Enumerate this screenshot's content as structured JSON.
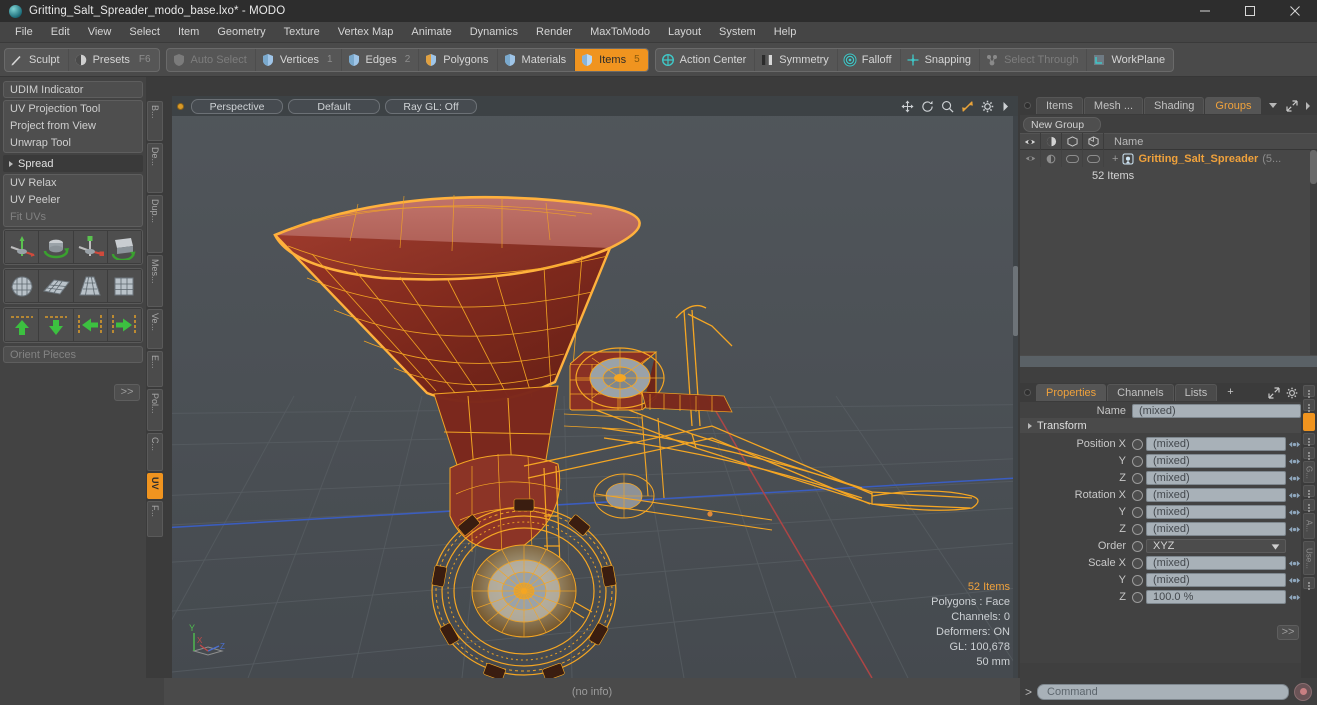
{
  "window": {
    "title": "Gritting_Salt_Spreader_modo_base.lxo* - MODO",
    "app_icon": "modo-sphere-icon",
    "minimize": "—",
    "maximize": "□",
    "close": "✕"
  },
  "menubar": {
    "items": [
      "File",
      "Edit",
      "View",
      "Select",
      "Item",
      "Geometry",
      "Texture",
      "Vertex Map",
      "Animate",
      "Dynamics",
      "Render",
      "MaxToModo",
      "Layout",
      "System",
      "Help"
    ]
  },
  "toolbar": {
    "groups": [
      {
        "buttons": [
          {
            "label": "Sculpt",
            "icon": "sculpt-brush-icon",
            "state": "normal",
            "key": ""
          },
          {
            "label": "Presets",
            "icon": "presets-sphere-icon",
            "state": "normal",
            "key": "F6"
          }
        ]
      },
      {
        "buttons": [
          {
            "label": "Auto Select",
            "icon": "shield-grey-icon",
            "state": "disabled",
            "key": ""
          },
          {
            "label": "Vertices",
            "icon": "shield-blue-icon",
            "state": "normal",
            "key": "1"
          },
          {
            "label": "Edges",
            "icon": "shield-blue-icon",
            "state": "normal",
            "key": "2"
          },
          {
            "label": "Polygons",
            "icon": "shield-blue-icon",
            "state": "normal",
            "key": ""
          },
          {
            "label": "Materials",
            "icon": "shield-blue-icon",
            "state": "normal",
            "key": ""
          },
          {
            "label": "Items",
            "icon": "shield-blue-icon",
            "state": "active",
            "key": "5"
          }
        ]
      },
      {
        "buttons": [
          {
            "label": "Action Center",
            "icon": "action-center-icon",
            "state": "normal",
            "key": ""
          },
          {
            "label": "Symmetry",
            "icon": "symmetry-icon",
            "state": "normal",
            "key": ""
          },
          {
            "label": "Falloff",
            "icon": "falloff-icon",
            "state": "normal",
            "key": ""
          },
          {
            "label": "Snapping",
            "icon": "snapping-icon",
            "state": "normal",
            "key": ""
          },
          {
            "label": "Select Through",
            "icon": "select-through-icon",
            "state": "disabled",
            "key": ""
          },
          {
            "label": "WorkPlane",
            "icon": "workplane-icon",
            "state": "normal",
            "key": ""
          }
        ]
      }
    ]
  },
  "left_panel": {
    "udim": "UDIM Indicator",
    "tools": [
      "UV Projection Tool",
      "Project from View",
      "Unwrap Tool"
    ],
    "spread_header": "Spread",
    "relax_tools": [
      "UV Relax",
      "UV Peeler",
      "Fit UVs"
    ],
    "relax_disabled_index": 2,
    "icon_rows": [
      [
        "move-uv-icon",
        "rotate-uv-icon",
        "scale-uv-icon",
        "flip-uv-icon"
      ],
      [
        "uv-sphere-grid-icon",
        "uv-plane-grid-icon",
        "uv-cone-grid-icon",
        "uv-box-grid-icon"
      ],
      [
        "align-up-icon",
        "align-down-icon",
        "align-left-icon",
        "align-right-icon"
      ]
    ],
    "orient_field": "Orient Pieces",
    "expand_label": ">>",
    "vtabs": [
      {
        "label": "B...",
        "active": false
      },
      {
        "label": "De...",
        "active": false
      },
      {
        "label": "Dup...",
        "active": false
      },
      {
        "label": "Mes...",
        "active": false
      },
      {
        "label": "Ve...",
        "active": false
      },
      {
        "label": "E...",
        "active": false
      },
      {
        "label": "Pol...",
        "active": false
      },
      {
        "label": "C...",
        "active": false
      },
      {
        "label": "UV",
        "active": true
      },
      {
        "label": "F...",
        "active": false
      }
    ]
  },
  "viewport": {
    "view_mode": "Perspective",
    "shading_preset": "Default",
    "ray_gl": "Ray GL: Off",
    "tools": [
      "move-icon",
      "rotate-icon",
      "zoom-icon",
      "fit-icon",
      "gear-icon",
      "play-icon"
    ],
    "active_tool_index": 3,
    "stats": {
      "items": "52 Items",
      "polygons": "Polygons : Face",
      "channels": "Channels: 0",
      "deformers": "Deformers: ON",
      "gl": "GL: 100,678",
      "scale": "50 mm"
    },
    "axis_labels": {
      "y": "Y",
      "x": "X",
      "z": "Z"
    }
  },
  "item_list": {
    "tabs": [
      {
        "label": "Items",
        "active": false
      },
      {
        "label": "Mesh ...",
        "active": false
      },
      {
        "label": "Shading",
        "active": false
      },
      {
        "label": "Groups",
        "active": true
      }
    ],
    "tab_menu_icon": "chevron-down-icon",
    "expand_icon": "expand-arrows-icon",
    "more_icon": "chevron-right-icon",
    "new_group_button": "New Group",
    "column_headers": {
      "eye": "visibility-icon",
      "shade": "shading-icon",
      "lock1": "render-icon",
      "lock2": "select-icon",
      "name": "Name"
    },
    "rows": [
      {
        "name": "Gritting_Salt_Spreader",
        "suffix": "(5...",
        "count": "52 Items",
        "icon": "group-icon"
      }
    ]
  },
  "properties": {
    "tabs": [
      {
        "label": "Properties",
        "active": true
      },
      {
        "label": "Channels",
        "active": false
      },
      {
        "label": "Lists",
        "active": false
      },
      {
        "label": "+",
        "active": false
      }
    ],
    "expand_icon": "expand-arrows-icon",
    "gear_icon": "gear-icon",
    "more_icon": "chevron-right-icon",
    "name_label": "Name",
    "name_value": "(mixed)",
    "transform_header": "Transform",
    "fields": [
      {
        "label": "Position X",
        "value": "(mixed)",
        "type": "mixed"
      },
      {
        "label": "Y",
        "value": "(mixed)",
        "type": "mixed"
      },
      {
        "label": "Z",
        "value": "(mixed)",
        "type": "mixed"
      },
      {
        "label": "Rotation X",
        "value": "(mixed)",
        "type": "mixed"
      },
      {
        "label": "Y",
        "value": "(mixed)",
        "type": "mixed"
      },
      {
        "label": "Z",
        "value": "(mixed)",
        "type": "mixed"
      },
      {
        "label": "Order",
        "value": "XYZ",
        "type": "dropdown"
      },
      {
        "label": "Scale X",
        "value": "(mixed)",
        "type": "mixed"
      },
      {
        "label": "Y",
        "value": "(mixed)",
        "type": "mixed"
      },
      {
        "label": "Z",
        "value": "100.0 %",
        "type": "value"
      }
    ],
    "expand_label": ">>",
    "vtabs": [
      {
        "label": "",
        "active": false,
        "grip": true
      },
      {
        "label": "",
        "active": false,
        "grip": true
      },
      {
        "label": "",
        "active": true,
        "grip": true
      },
      {
        "label": "",
        "active": false,
        "grip": true
      },
      {
        "label": "",
        "active": false,
        "grip": true
      },
      {
        "label": "G...",
        "active": false,
        "grip": false
      },
      {
        "label": "",
        "active": false,
        "grip": true
      },
      {
        "label": "",
        "active": false,
        "grip": true
      },
      {
        "label": "A...",
        "active": false,
        "grip": false
      },
      {
        "label": "Use...",
        "active": false,
        "grip": false
      },
      {
        "label": "",
        "active": false,
        "grip": true
      }
    ]
  },
  "command_bar": {
    "prompt": ">",
    "placeholder": "Command",
    "record_icon": "record-icon"
  },
  "statusbar": {
    "text": "(no info)"
  },
  "colors": {
    "accent": "#f0941f",
    "accent_text": "#f0a23c",
    "window_bg": "#3b3b3b",
    "panel_bg": "#434343",
    "toolbar_bg": "#4a4a4a",
    "viewport_bg": "#4b5055",
    "wireframe": "#f5a623",
    "mesh_fill": "#8f2f22",
    "field_bg": "#a8b1b8"
  }
}
